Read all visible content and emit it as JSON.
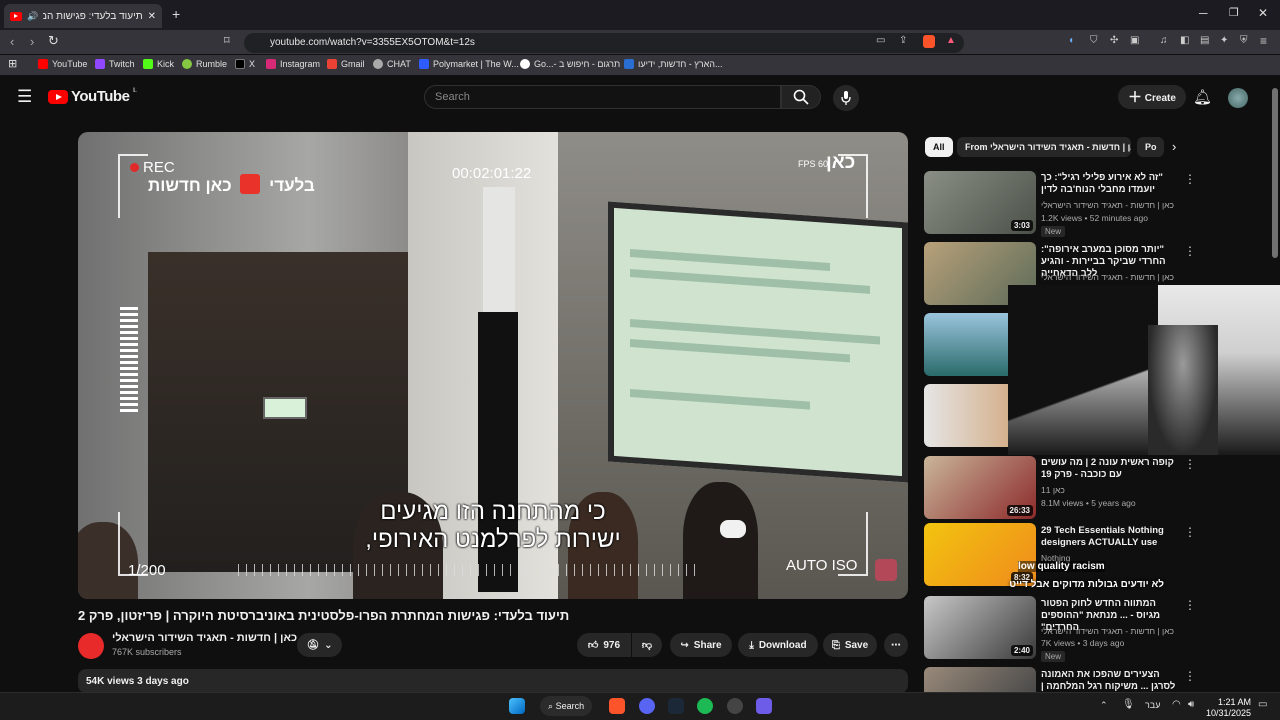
{
  "browser": {
    "tab_title": "תיעוד בלעדי: פגישות המחתרה",
    "url": "youtube.com/watch?v=3355EX5OTOM&t=12s",
    "new_tab": "+",
    "bookmarks": [
      "YouTube",
      "Twitch",
      "Kick",
      "Rumble",
      "X",
      "Instagram",
      "Gmail",
      "CHAT",
      "Polymarket | The W...",
      "Go...- תרגום - חיפוש ב",
      "הארץ - חדשות, ידיעו..."
    ]
  },
  "yt_header": {
    "logo": "YouTube",
    "country": "IL",
    "search_placeholder": "Search",
    "create_label": "Create"
  },
  "video": {
    "rec": "REC",
    "kan_label_1": "כאן חדשות",
    "exclusive": "בלעדי",
    "timecode": "00:02:01:22",
    "fps": "FPS 60",
    "kan_label_2": "כאן",
    "subtitle_line1": "כי מהתחנה הזו מגיעים",
    "subtitle_line2": "ישירות לפרלמנט האירופי,",
    "frame_counter": "1/200",
    "auto_iso": "AUTO ISO",
    "title": "תיעוד בלעדי: פגישות המחתרת הפרו-פלסטינית באוניברסיטת היוקרה | פריזטון, פרק 2",
    "channel": "כאן | חדשות - תאגיד השידור הישראלי",
    "subscribers": "767K subscribers",
    "likes": "976",
    "share": "Share",
    "download": "Download",
    "save": "Save",
    "views_date": "54K views  3 days ago"
  },
  "chips": [
    "All",
    "From כאן | חדשות - תאגיד השידור הישראלי",
    "Po"
  ],
  "related": [
    {
      "title": "\"זה לא אירוע פלילי רגיל\": כך יועמדו מחבלי הנוח'בה לדין",
      "channel": "כאן | חדשות - תאגיד השידור הישראלי",
      "meta": "1.2K views • 52 minutes ago",
      "duration": "3:03",
      "badge": "New"
    },
    {
      "title": "\"יותר מסוכן במערב אירופה\": החרדי שביקר בביירות - והגיע ללב הדאחייה",
      "channel": "כאן | חדשות - תאגיד השידור הישראלי",
      "meta": "",
      "duration": "",
      "badge": ""
    },
    {
      "title": "קופה ראשית עונה 2 | מה עושים עם כוכבה - פרק 19",
      "channel": "כאן 11",
      "meta": "8.1M views • 5 years ago",
      "duration": "26:33",
      "badge": ""
    },
    {
      "title": "29 Tech Essentials Nothing designers ACTUALLY use",
      "channel": "Nothing",
      "meta": "",
      "duration": "8:32",
      "badge": ""
    },
    {
      "title": "המתווה החדש לחוק הפטור מגיוס - ... מנתאת \"ההוספים החרדים\"",
      "channel": "כאן | חדשות - תאגיד השידור הישראלי",
      "meta": "7K views • 3 days ago",
      "duration": "2:40",
      "badge": "New"
    },
    {
      "title": "הצעירים שהפכו את האמונה לסרגן ... משיקוח רגל המלחמה | אלוקים",
      "channel": "",
      "meta": "",
      "duration": "",
      "badge": ""
    }
  ],
  "overlay": {
    "caption": "low quality racism",
    "caption_he": "לא יודעים גבולות מדוקים אבל דייט"
  },
  "taskbar": {
    "search": "Search",
    "lang": "עבר",
    "time": "1:21 AM",
    "date": "10/31/2025"
  },
  "colors": {
    "bg": "#0f0f0f",
    "accent": "#ff0000",
    "chip": "#272727"
  }
}
